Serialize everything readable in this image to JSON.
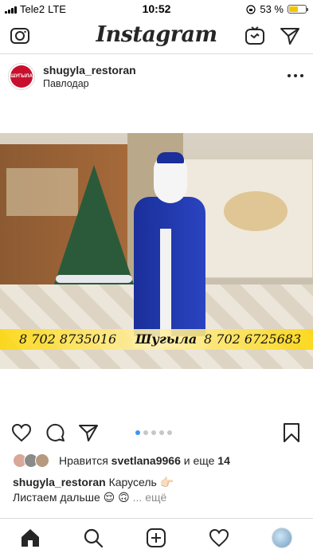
{
  "status_bar": {
    "carrier": "Tele2",
    "network": "LTE",
    "time": "10:52",
    "battery_percent_label": "53 %",
    "battery_level": 0.53,
    "battery_color": "#f5c400"
  },
  "header": {
    "logo": "Instagram",
    "camera_icon": "camera-icon",
    "igtv_icon": "igtv-icon",
    "direct_icon": "direct-message-icon"
  },
  "post": {
    "username": "shugyla_restoran",
    "location": "Павлодар",
    "avatar_label": "ШУГЫЛА",
    "photo": {
      "phone_left": "8 702 8735016",
      "brand_text": "Шугыла",
      "phone_right": "8 702 6725683"
    },
    "carousel": {
      "count": 5,
      "active_index": 0
    },
    "likes": {
      "prefix": "Нравится",
      "user": "svetlana9966",
      "conj": "и еще",
      "count": "14"
    },
    "caption": {
      "username": "shugyla_restoran",
      "line1": "Карусель 👉🏻",
      "line2": "Листаем дальше 😌 🙃",
      "ellipsis": "...",
      "more": "ещё"
    }
  },
  "tab_bar": {
    "items": [
      "home-icon",
      "search-icon",
      "new-post-icon",
      "activity-icon",
      "profile-avatar"
    ],
    "active": "home-icon"
  },
  "colors": {
    "accent": "#3897f0",
    "text": "#262626",
    "muted": "#8e8e8e",
    "border": "#dbdbdb"
  }
}
